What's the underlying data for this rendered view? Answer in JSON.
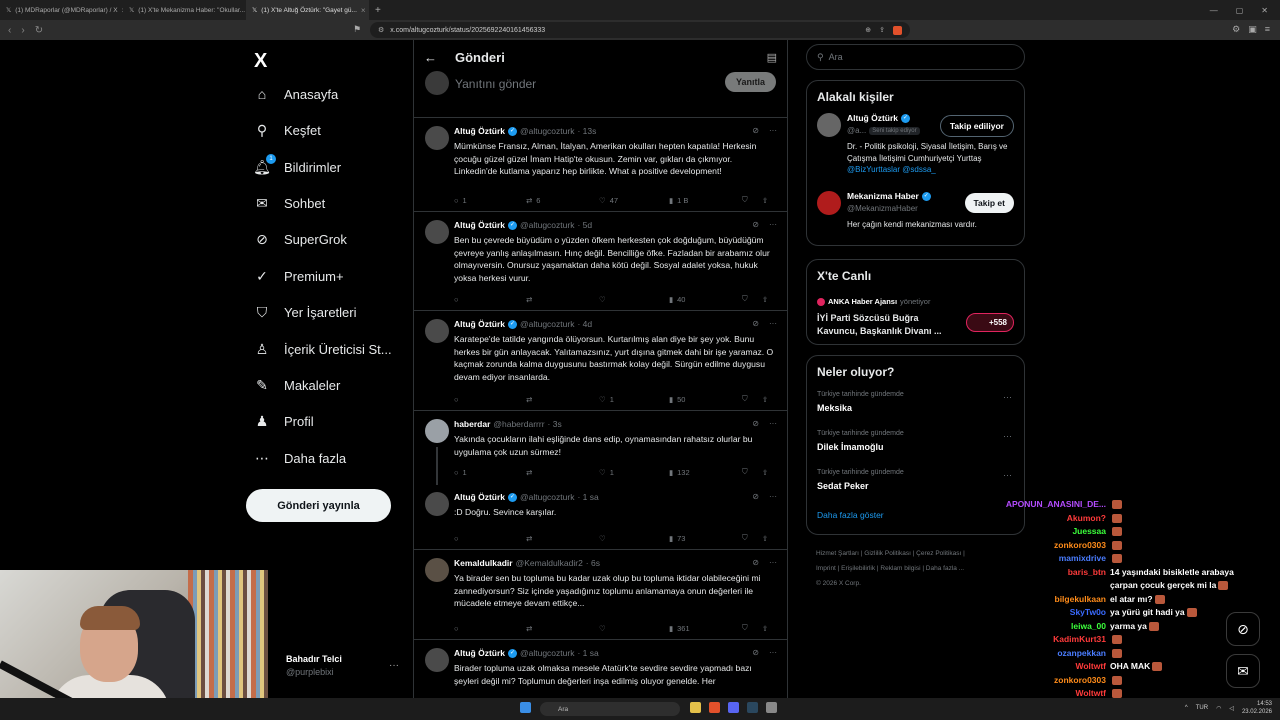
{
  "browser": {
    "tabs": [
      {
        "label": "(1) MDRaporlar (@MDRaporlar) / X"
      },
      {
        "label": "(1) X'te Mekanizma Haber: \"Okullar..."
      },
      {
        "label": "(1) X'te Altuğ Öztürk: \"Gayet gü..."
      }
    ],
    "url": "x.com/altugcozturk/status/2025692240161456333"
  },
  "nav": {
    "logo": "X",
    "items": [
      {
        "label": "Anasayfa",
        "icon": "home-icon"
      },
      {
        "label": "Keşfet",
        "icon": "search-icon"
      },
      {
        "label": "Bildirimler",
        "icon": "bell-icon",
        "badge": "1"
      },
      {
        "label": "Sohbet",
        "icon": "mail-icon"
      },
      {
        "label": "SuperGrok",
        "icon": "grok-icon"
      },
      {
        "label": "Premium+",
        "icon": "premium-icon"
      },
      {
        "label": "Yer İşaretleri",
        "icon": "bookmark-icon"
      },
      {
        "label": "İçerik Üreticisi St...",
        "icon": "studio-icon"
      },
      {
        "label": "Makaleler",
        "icon": "article-icon"
      },
      {
        "label": "Profil",
        "icon": "person-icon"
      },
      {
        "label": "Daha fazla",
        "icon": "more-icon"
      }
    ],
    "post_button": "Gönderi yayınla",
    "account": {
      "name": "Bahadır Telci",
      "handle": "@purplebixi"
    }
  },
  "main": {
    "title": "Gönderi",
    "reply_placeholder": "Yanıtını gönder",
    "reply_button": "Yanıtla",
    "tweets": [
      {
        "name": "Altuğ Öztürk",
        "verified": true,
        "handle": "@altugcozturk",
        "time": "· 13s",
        "text": "Mümkünse Fransız, Alman, İtalyan, Amerikan okulları hepten kapatıla! Herkesin çocuğu güzel güzel İmam Hatip'te okusun. Zemin var, gıkları da çıkmıyor. Linkedin'de kutlama yaparız hep birlikte. What a positive development!",
        "replies": "1",
        "reposts": "6",
        "likes": "47",
        "views": "1 B"
      },
      {
        "name": "Altuğ Öztürk",
        "verified": true,
        "handle": "@altugcozturk",
        "time": "· 5d",
        "text": "Ben bu çevrede büyüdüm o yüzden öfkem herkesten çok doğduğum, büyüdüğüm çevreye yanlış anlaşılmasın. Hınç değil. Bencilliğe öfke. Fazladan bir arabamız olur olmayıversin. Onursuz yaşamaktan daha kötü değil. Sosyal adalet yoksa, hukuk yoksa herkesi vurur.",
        "replies": "",
        "reposts": "",
        "likes": "",
        "views": "40"
      },
      {
        "name": "Altuğ Öztürk",
        "verified": true,
        "handle": "@altugcozturk",
        "time": "· 4d",
        "text": "Karatepe'de tatilde yangında ölüyorsun. Kurtarılmış alan diye bir şey yok. Bunu herkes bir gün anlayacak. Yalıtamazsınız, yurt dışına gitmek dahi bir işe yaramaz. O kaçmak zorunda kalma duygusunu bastırmak kolay değil. Sürgün edilme duygusu devam ediyor insanlarda.",
        "replies": "",
        "reposts": "",
        "likes": "1",
        "views": "50"
      },
      {
        "name": "haberdar",
        "verified": false,
        "handle": "@haberdarrrr",
        "time": "· 3s",
        "text": "Yakında çocukların ilahi eşliğinde dans edip, oynamasından rahatsız olurlar bu uygulama çok uzun sürmez!",
        "replies": "1",
        "reposts": "",
        "likes": "1",
        "views": "132"
      },
      {
        "name": "Altuğ Öztürk",
        "verified": true,
        "handle": "@altugcozturk",
        "time": "· 1 sa",
        "text": ":D Doğru. Sevince karşılar.",
        "replies": "",
        "reposts": "",
        "likes": "",
        "views": "73"
      },
      {
        "name": "Kemaldulkadir",
        "verified": false,
        "handle": "@Kemaldulkadir2",
        "time": "· 6s",
        "text": "Ya birader sen bu topluma bu kadar uzak olup bu topluma iktidar olabileceğini mi zannediyorsun? Siz içinde yaşadığınız toplumu anlamamaya onun değerleri ile mücadele etmeye devam ettikçe...",
        "replies": "",
        "reposts": "",
        "likes": "",
        "views": "361"
      },
      {
        "name": "Altuğ Öztürk",
        "verified": true,
        "handle": "@altugcozturk",
        "time": "· 1 sa",
        "text": "Birader topluma uzak olmaksa mesele Atatürk'te sevdire sevdire yapmadı bazı şeyleri değil mi? Toplumun değerleri inşa edilmiş oluyor genelde. Her",
        "replies": "",
        "reposts": "",
        "likes": "",
        "views": ""
      }
    ]
  },
  "right": {
    "search_placeholder": "Ara",
    "related": {
      "title": "Alakalı kişiler",
      "people": [
        {
          "name": "Altuğ Öztürk",
          "handle": "@a...",
          "follows_you": "Seni takip ediyor",
          "button": "Takip ediliyor",
          "bio": "Dr. - Politik psikoloji, Siyasal İletişim, Barış ve Çatışma İletişimi Cumhuriyetçi Yurttaş",
          "bio_links": "@BizYurttaslar @sdssa_"
        },
        {
          "name": "Mekanizma Haber",
          "handle": "@MekanizmaHaber",
          "button": "Takip et",
          "bio": "Her çağın kendi mekanizması vardır."
        }
      ]
    },
    "live": {
      "title": "X'te Canlı",
      "host": "ANKA Haber Ajansı",
      "role": "yönetiyor",
      "headline": "İYİ Parti Sözcüsü Buğra Kavuncu, Başkanlık Divanı ...",
      "count": "+558"
    },
    "trends": {
      "title": "Neler oluyor?",
      "items": [
        {
          "context": "Türkiye tarihinde gündemde",
          "name": "Meksika"
        },
        {
          "context": "Türkiye tarihinde gündemde",
          "name": "Dilek İmamoğlu"
        },
        {
          "context": "Türkiye tarihinde gündemde",
          "name": "Sedat Peker"
        }
      ],
      "show_more": "Daha fazla göster"
    },
    "footer": {
      "line1": "Hizmet Şartları | Gizlilik Politikası | Çerez Politikası |",
      "line2": "Imprint | Erişilebilirlik | Reklam bilgisi | Daha fazla ...",
      "line3": "© 2026 X Corp."
    }
  },
  "chat": [
    {
      "user": "APONUN_ANASINI_DE...",
      "color": "#b44cff",
      "msg": ""
    },
    {
      "user": "Akumon?",
      "color": "#ff3b3b",
      "msg": ""
    },
    {
      "user": "Juessaa",
      "color": "#3bff3b",
      "msg": ""
    },
    {
      "user": "zonkoro0303",
      "color": "#ff8c1a",
      "msg": ""
    },
    {
      "user": "mamixdrive",
      "color": "#4a7dff",
      "msg": ""
    },
    {
      "user": "baris_btn",
      "color": "#ff3b3b",
      "msg": "14 yaşındaki bisikletle arabaya çarpan çocuk gerçek mi la"
    },
    {
      "user": "bilgekulkaan",
      "color": "#ff8c1a",
      "msg": "el atar mı?"
    },
    {
      "user": "SkyTw0o",
      "color": "#3a6bff",
      "msg": "ya yürü git hadi ya"
    },
    {
      "user": "leiwa_00",
      "color": "#3bff3b",
      "msg": "yarma ya"
    },
    {
      "user": "KadimKurt31",
      "color": "#ff3b3b",
      "msg": ""
    },
    {
      "user": "ozanpekkan",
      "color": "#4a7dff",
      "msg": ""
    },
    {
      "user": "Woltwtf",
      "color": "#ff3b3b",
      "msg": "OHA MAK"
    },
    {
      "user": "zonkoro0303",
      "color": "#ff8c1a",
      "msg": ""
    },
    {
      "user": "Woltwtf",
      "color": "#ff3b3b",
      "msg": ""
    }
  ],
  "taskbar": {
    "search": "Ara",
    "lang": "TUR",
    "time": "14:53",
    "date": "23.02.2026"
  }
}
